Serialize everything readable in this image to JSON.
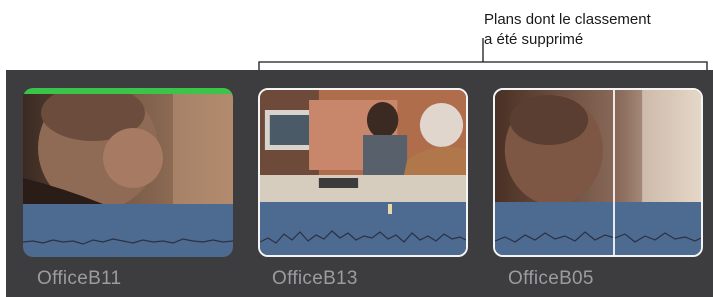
{
  "callout": {
    "line1": "Plans dont le classement",
    "line2": "a été supprimé"
  },
  "clips": [
    {
      "name": "OfficeB11",
      "state": "favorite",
      "rating_color": "#3ac44a"
    },
    {
      "name": "OfficeB13",
      "state": "selected"
    },
    {
      "name": "OfficeB05",
      "state": "selected"
    }
  ],
  "colors": {
    "browser_bg": "#3d3d3f",
    "waveform": "#4d6a91",
    "selection_border": "#f4f4f4",
    "favorite_bar": "#3ac44a"
  }
}
